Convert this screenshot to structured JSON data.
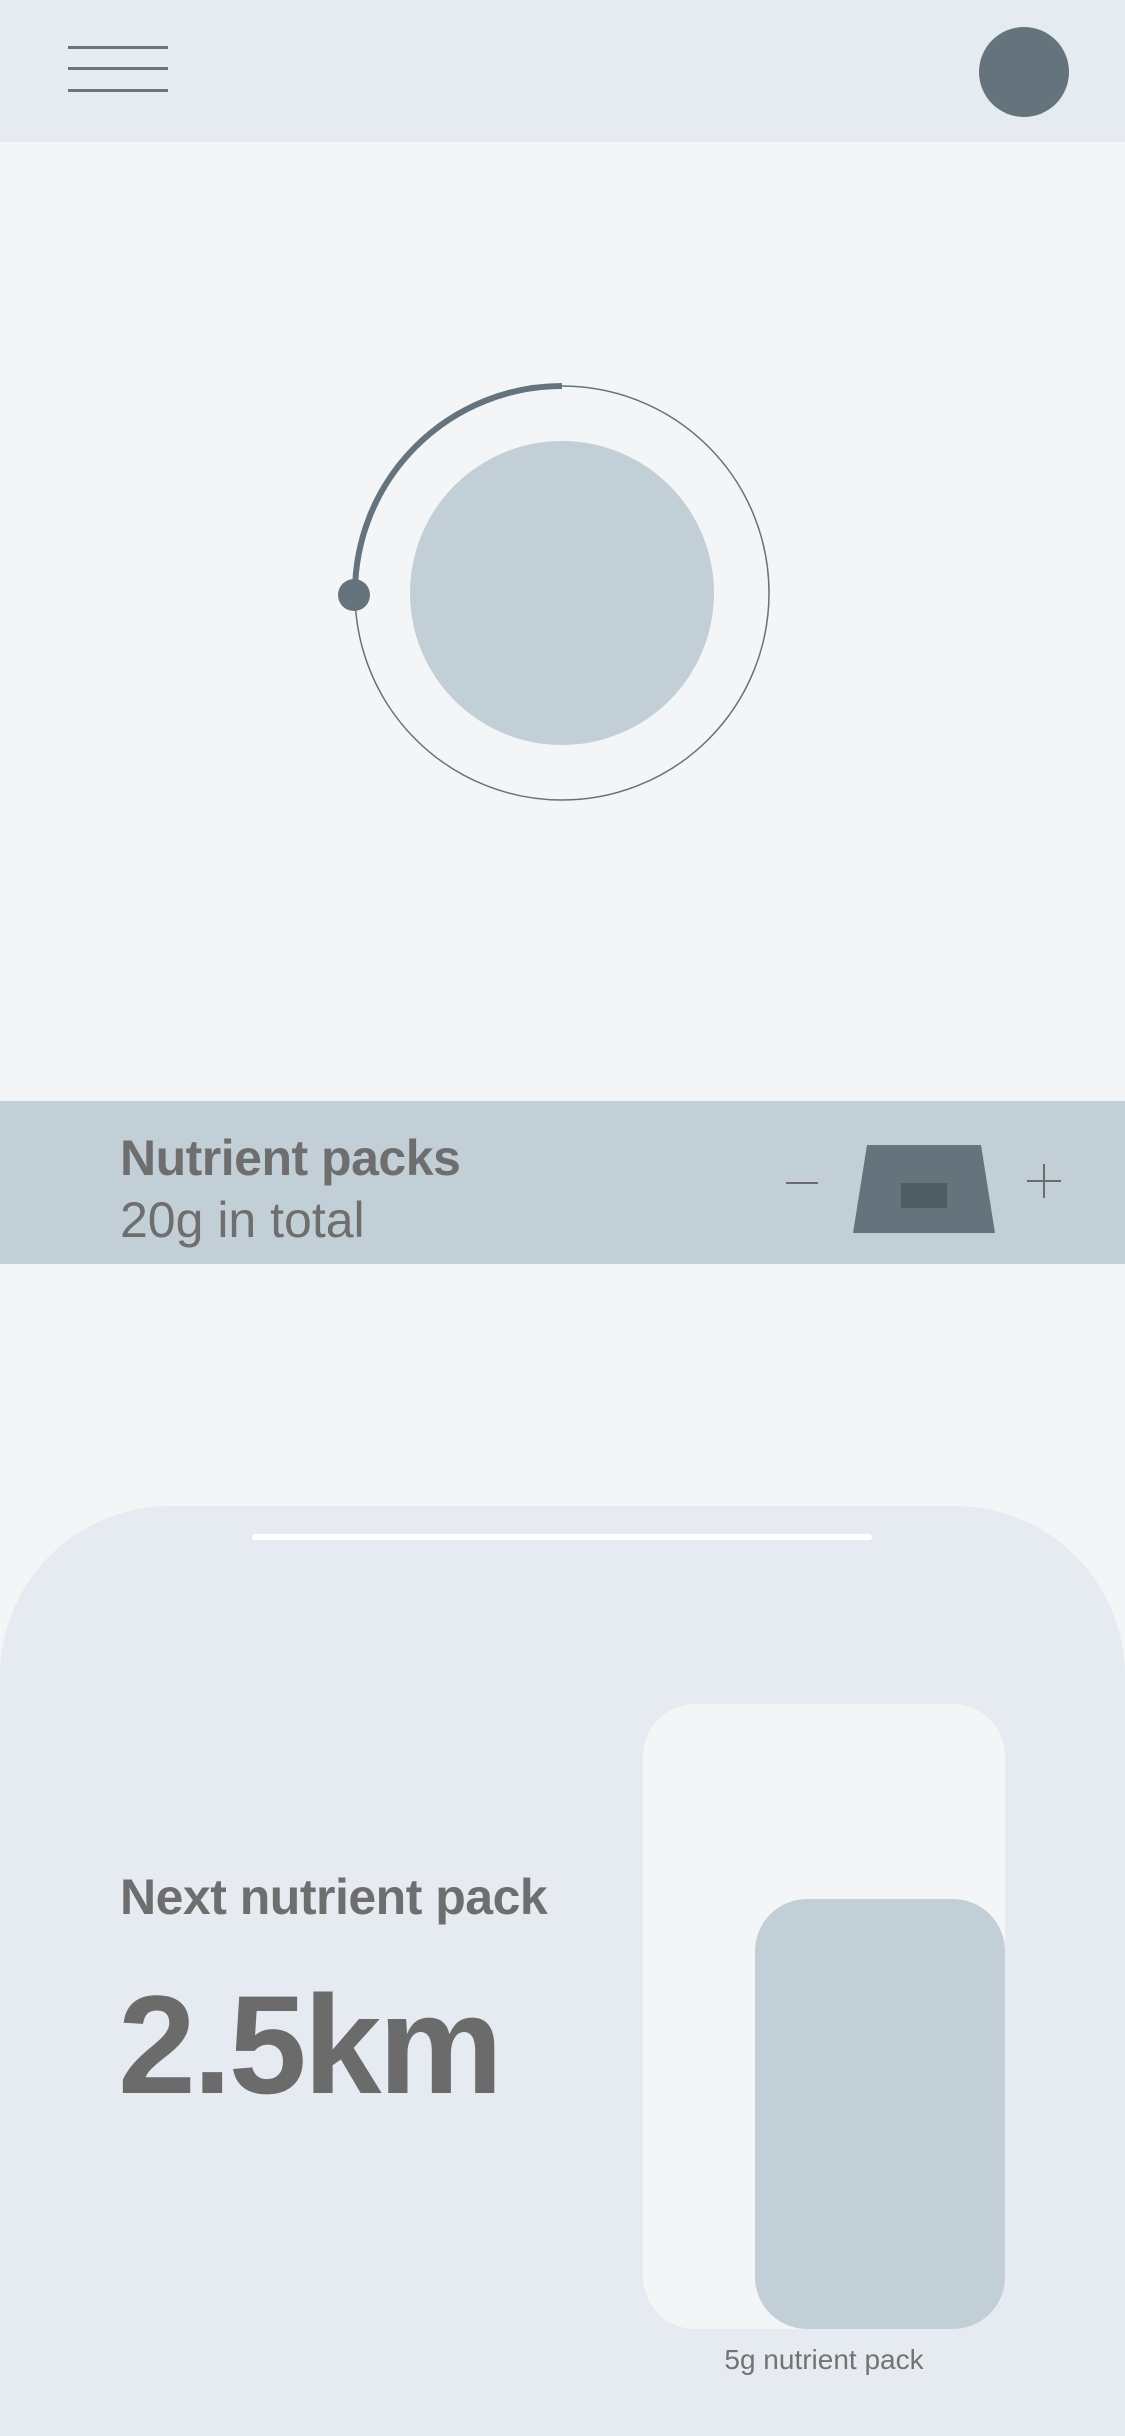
{
  "header": {
    "menu_icon": "hamburger-menu-icon",
    "avatar": "profile-avatar"
  },
  "dial": {
    "progress_fraction": 0.25,
    "progress_color": "#64737c",
    "track_color": "#64737c",
    "center_color": "#c3cfd7"
  },
  "packs": {
    "title": "Nutrient packs",
    "subtitle": "20g in total",
    "decrement_symbol": "minus-icon",
    "increment_symbol": "plus-icon",
    "pack_icon": "nutrient-pack-icon"
  },
  "next": {
    "label": "Next nutrient pack",
    "distance": "2.5km",
    "pack_caption": "5g nutrient pack",
    "pack_fill_fraction": 0.69
  },
  "colors": {
    "header_bg": "#e5ebf0",
    "page_bg": "#f3f5f7",
    "band_bg": "#c3cfd7",
    "accent": "#64737c"
  }
}
